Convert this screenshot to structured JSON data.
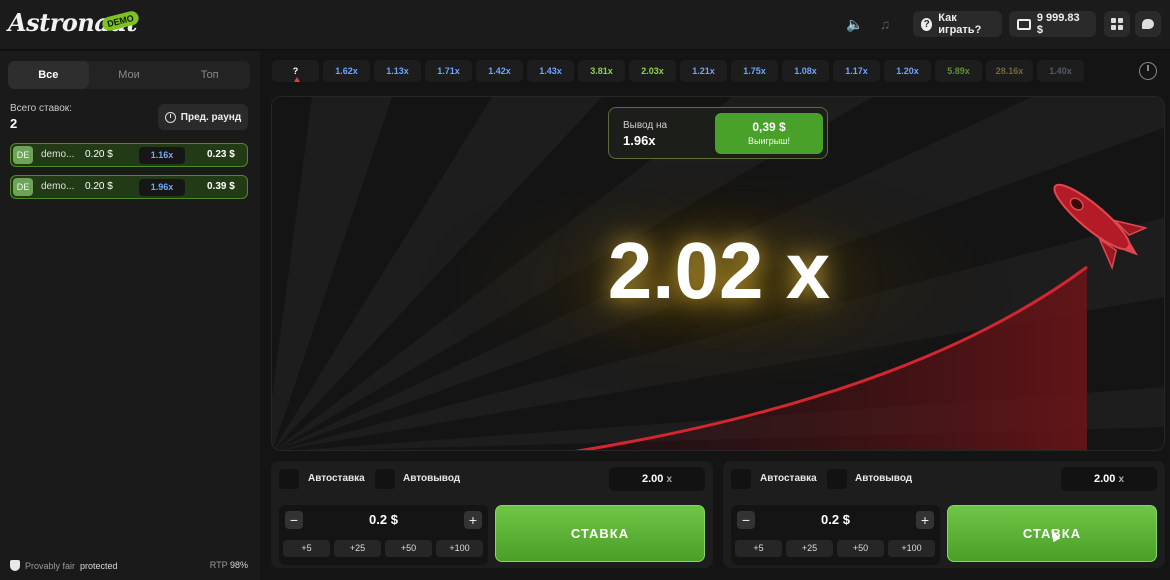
{
  "header": {
    "logo_text": "Astronaut",
    "logo_badge": "DEMO",
    "how_to_play": "Как играть?",
    "balance": "9 999.83 $"
  },
  "sidebar": {
    "tabs": [
      "Все",
      "Мои",
      "Топ"
    ],
    "total_bets_label": "Всего ставок:",
    "total_bets_value": "2",
    "prev_round_label": "Пред. раунд",
    "bets": [
      {
        "avatar": "DE",
        "name": "demo...",
        "amount": "0.20 $",
        "multiplier": "1.16x",
        "win": "0.23 $"
      },
      {
        "avatar": "DE",
        "name": "demo...",
        "amount": "0.20 $",
        "multiplier": "1.96x",
        "win": "0.39 $"
      }
    ],
    "provably_fair_a": "Provably fair",
    "provably_fair_b": "protected",
    "rtp_label": "RTP",
    "rtp_value": "98%"
  },
  "history": [
    {
      "value": "?",
      "color": "#ffffff"
    },
    {
      "value": "1.62x",
      "color": "#6ea4ff"
    },
    {
      "value": "1.13x",
      "color": "#6ea4ff"
    },
    {
      "value": "1.71x",
      "color": "#6ea4ff"
    },
    {
      "value": "1.42x",
      "color": "#6ea4ff"
    },
    {
      "value": "1.43x",
      "color": "#6ea4ff"
    },
    {
      "value": "3.81x",
      "color": "#8fd14f"
    },
    {
      "value": "2.03x",
      "color": "#8fd14f"
    },
    {
      "value": "1.21x",
      "color": "#6ea4ff"
    },
    {
      "value": "1.75x",
      "color": "#6ea4ff"
    },
    {
      "value": "1.08x",
      "color": "#6ea4ff"
    },
    {
      "value": "1.17x",
      "color": "#6ea4ff"
    },
    {
      "value": "1.20x",
      "color": "#6ea4ff"
    },
    {
      "value": "5.89x",
      "color": "#5f8f3a"
    },
    {
      "value": "28.16x",
      "color": "#6f6a3a"
    },
    {
      "value": "1.40x",
      "color": "#555a66"
    }
  ],
  "game": {
    "multiplier": "2.02 x",
    "cashout_label": "Вывод на",
    "cashout_multiplier": "1.96x",
    "cashout_amount": "0,39 $",
    "cashout_win_label": "Выигрыш!"
  },
  "bet_panels": [
    {
      "autobet_label": "Автоставка",
      "autocash_label": "Автовывод",
      "autocash_value": "2.00",
      "autocash_unit": "x",
      "amount": "0.2 $",
      "minus": "−",
      "plus": "+",
      "quick": [
        "+5",
        "+25",
        "+50",
        "+100"
      ],
      "bet_label": "СТАВКА"
    },
    {
      "autobet_label": "Автоставка",
      "autocash_label": "Автовывод",
      "autocash_value": "2.00",
      "autocash_unit": "x",
      "amount": "0.2 $",
      "minus": "−",
      "plus": "+",
      "quick": [
        "+5",
        "+25",
        "+50",
        "+100"
      ],
      "bet_label": "СТАВКА"
    }
  ],
  "colors": {
    "accent_green": "#4aa12a",
    "rocket_red": "#c8202a",
    "low_multiplier_blue": "#6ea4ff"
  }
}
